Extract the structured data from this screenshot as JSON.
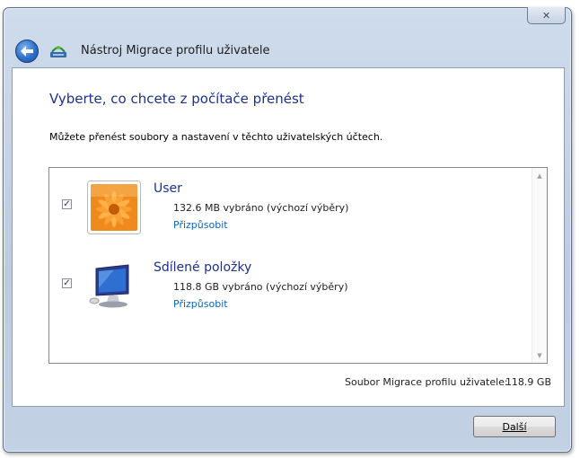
{
  "window": {
    "title": "Nástroj Migrace profilu uživatele",
    "close_symbol": "✕"
  },
  "icons": {
    "back": "back-arrow-icon",
    "app": "migration-tool-icon",
    "close": "close-icon"
  },
  "page": {
    "heading": "Vyberte, co chcete z počítače přenést",
    "intro": "Můžete přenést soubory a nastavení v těchto uživatelských účtech."
  },
  "accounts": [
    {
      "name": "User",
      "size": "132.6 MB vybráno (výchozí výběry)",
      "customize": "Přizpůsobit",
      "checked": true,
      "icon": "user-flower-picture-icon"
    },
    {
      "name": "Sdílené položky",
      "size": "118.8 GB vybráno (výchozí výběry)",
      "customize": "Přizpůsobit",
      "checked": true,
      "icon": "shared-items-computer-icon"
    }
  ],
  "summary": {
    "label": "Soubor Migrace profilu uživatele:",
    "value": "118.9 GB"
  },
  "buttons": {
    "next": "Další"
  },
  "colors": {
    "heading": "#1e3287",
    "link": "#0a64b4",
    "frame": "#bccbe0"
  }
}
